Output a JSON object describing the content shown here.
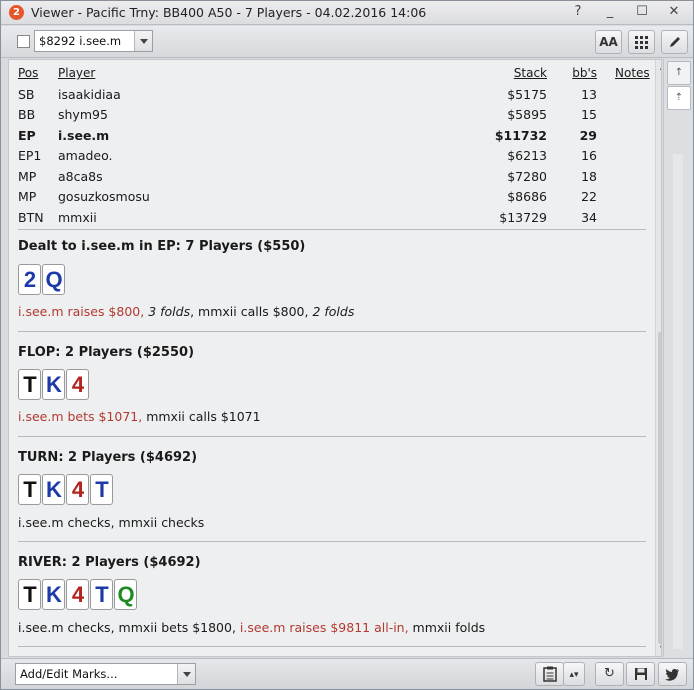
{
  "window": {
    "app_icon_text": "2",
    "title": "Viewer - Pacific Trny: BB400 A50 - 7 Players - 04.02.2016 14:06",
    "buttons": [
      "?",
      "_",
      "☐",
      "✕"
    ]
  },
  "toolbar": {
    "hand_select_value": "$8292 i.see.m",
    "font_button_label": "AA"
  },
  "players_table": {
    "headers": {
      "pos": "Pos",
      "player": "Player",
      "stack": "Stack",
      "bbs": "bb's",
      "notes": "Notes"
    },
    "rows": [
      {
        "pos": "SB",
        "player": "isaakidiaa",
        "stack": "$5175",
        "bbs": "13"
      },
      {
        "pos": "BB",
        "player": "shym95",
        "stack": "$5895",
        "bbs": "15"
      },
      {
        "pos": "EP",
        "player": "i.see.m",
        "stack": "$11732",
        "bbs": "29"
      },
      {
        "pos": "EP1",
        "player": "amadeo.",
        "stack": "$6213",
        "bbs": "16"
      },
      {
        "pos": "MP",
        "player": "a8ca8s",
        "stack": "$7280",
        "bbs": "18"
      },
      {
        "pos": "MP",
        "player": "gosuzkosmosu",
        "stack": "$8686",
        "bbs": "22"
      },
      {
        "pos": "BTN",
        "player": "mmxii",
        "stack": "$13729",
        "bbs": "34"
      }
    ]
  },
  "streets": {
    "preflop": {
      "title": "Dealt to i.see.m in EP: 7 Players ($550)",
      "cards": [
        {
          "rank": "2",
          "suit": "blue"
        },
        {
          "rank": "Q",
          "suit": "blue"
        }
      ],
      "action": {
        "a1": "i.see.m raises $800,",
        "a2": "3 folds",
        "a3": ", mmxii calls $800, ",
        "a4": "2 folds"
      }
    },
    "flop": {
      "title": "FLOP: 2 Players ($2550)",
      "cards": [
        {
          "rank": "T",
          "suit": "black"
        },
        {
          "rank": "K",
          "suit": "blue"
        },
        {
          "rank": "4",
          "suit": "red"
        }
      ],
      "action": {
        "a1": "i.see.m bets $1071,",
        "a2": " mmxii calls $1071"
      }
    },
    "turn": {
      "title": "TURN: 2 Players ($4692)",
      "cards": [
        {
          "rank": "T",
          "suit": "black"
        },
        {
          "rank": "K",
          "suit": "blue"
        },
        {
          "rank": "4",
          "suit": "red"
        },
        {
          "rank": "T",
          "suit": "blue"
        }
      ],
      "action": {
        "a1": "i.see.m checks, mmxii checks"
      }
    },
    "river": {
      "title": "RIVER: 2 Players ($4692)",
      "cards": [
        {
          "rank": "T",
          "suit": "black"
        },
        {
          "rank": "K",
          "suit": "blue"
        },
        {
          "rank": "4",
          "suit": "red"
        },
        {
          "rank": "T",
          "suit": "blue"
        },
        {
          "rank": "Q",
          "suit": "green"
        }
      ],
      "action": {
        "a1": "i.see.m checks, mmxii bets $1800, ",
        "a2": "i.see.m raises $9811 all-in,",
        "a3": " mmxii folds"
      }
    }
  },
  "bottom": {
    "marks_select_value": "Add/Edit Marks..."
  },
  "colors": {
    "hero_action": "#b23a2e",
    "card_black": "#111111",
    "card_blue": "#1c3aa8",
    "card_red": "#b2231e",
    "card_green": "#1d8a22"
  }
}
